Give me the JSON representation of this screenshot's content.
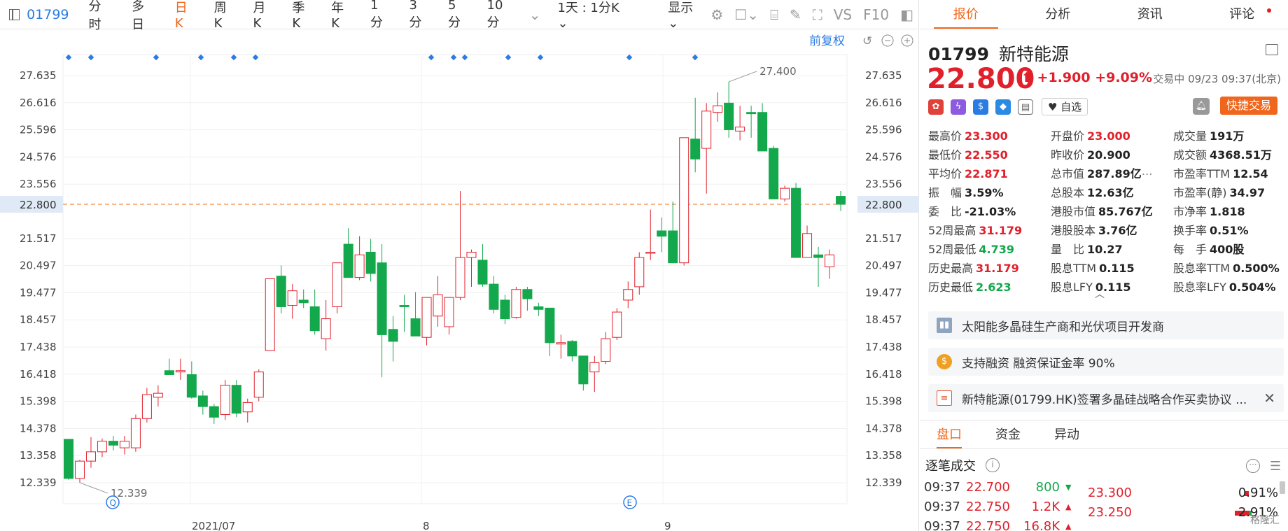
{
  "toolbar": {
    "code": "01799",
    "tabs": [
      "分时",
      "多日",
      "日K",
      "周K",
      "月K",
      "季K",
      "年K",
      "1分",
      "3分",
      "5分",
      "10分"
    ],
    "active_tab": "日K",
    "period_select": "1天 : 1分K",
    "display_select": "显示",
    "fq_label": "前复权",
    "vs_label": "VS",
    "f10_label": "F10"
  },
  "chart_data": {
    "type": "candlestick",
    "y_ticks": [
      "27.635",
      "26.616",
      "25.596",
      "24.576",
      "23.556",
      "22.800",
      "21.517",
      "20.497",
      "19.477",
      "18.457",
      "17.438",
      "16.418",
      "15.398",
      "14.378",
      "13.358",
      "12.339"
    ],
    "ylim": [
      12.339,
      27.635
    ],
    "x_labels": [
      "2021/07",
      "8",
      "9"
    ],
    "current_price_line": 22.8,
    "current_price_label": "22.800",
    "max_label": "27.400",
    "min_label": "12.339",
    "colors": {
      "up": "#e0202b",
      "down": "#14a84c",
      "price_line": "#f28a4a"
    },
    "candles": [
      {
        "o": 13.97,
        "h": 13.97,
        "l": 12.45,
        "c": 12.5
      },
      {
        "o": 12.5,
        "h": 13.2,
        "l": 12.34,
        "c": 13.15
      },
      {
        "o": 13.15,
        "h": 14.05,
        "l": 12.9,
        "c": 13.5
      },
      {
        "o": 13.5,
        "h": 14.0,
        "l": 13.3,
        "c": 13.9
      },
      {
        "o": 13.9,
        "h": 14.1,
        "l": 13.55,
        "c": 13.75
      },
      {
        "o": 13.65,
        "h": 14.1,
        "l": 13.4,
        "c": 13.9
      },
      {
        "o": 13.65,
        "h": 14.9,
        "l": 13.5,
        "c": 14.75
      },
      {
        "o": 14.75,
        "h": 15.9,
        "l": 14.6,
        "c": 15.65
      },
      {
        "o": 15.55,
        "h": 16.0,
        "l": 15.2,
        "c": 15.7
      },
      {
        "o": 16.55,
        "h": 17.0,
        "l": 16.4,
        "c": 16.4
      },
      {
        "o": 16.5,
        "h": 17.0,
        "l": 16.2,
        "c": 16.55
      },
      {
        "o": 16.4,
        "h": 16.9,
        "l": 15.5,
        "c": 15.55
      },
      {
        "o": 15.6,
        "h": 15.8,
        "l": 14.9,
        "c": 15.2
      },
      {
        "o": 15.2,
        "h": 15.3,
        "l": 14.55,
        "c": 14.8
      },
      {
        "o": 14.9,
        "h": 16.2,
        "l": 14.7,
        "c": 16.0
      },
      {
        "o": 16.0,
        "h": 16.2,
        "l": 14.8,
        "c": 14.95
      },
      {
        "o": 15.0,
        "h": 15.5,
        "l": 14.6,
        "c": 15.35
      },
      {
        "o": 15.55,
        "h": 16.6,
        "l": 15.4,
        "c": 16.5
      },
      {
        "o": 17.3,
        "h": 20.0,
        "l": 17.3,
        "c": 20.0
      },
      {
        "o": 20.1,
        "h": 20.5,
        "l": 18.7,
        "c": 18.95
      },
      {
        "o": 19.0,
        "h": 19.8,
        "l": 18.5,
        "c": 19.55
      },
      {
        "o": 19.2,
        "h": 19.6,
        "l": 18.9,
        "c": 19.1
      },
      {
        "o": 18.95,
        "h": 19.6,
        "l": 17.9,
        "c": 18.05
      },
      {
        "o": 17.75,
        "h": 19.2,
        "l": 17.3,
        "c": 18.5
      },
      {
        "o": 18.95,
        "h": 20.6,
        "l": 18.7,
        "c": 20.6
      },
      {
        "o": 21.3,
        "h": 21.9,
        "l": 20.1,
        "c": 20.05
      },
      {
        "o": 20.05,
        "h": 21.6,
        "l": 19.95,
        "c": 20.9
      },
      {
        "o": 21.0,
        "h": 21.5,
        "l": 19.9,
        "c": 20.2
      },
      {
        "o": 20.6,
        "h": 21.3,
        "l": 16.3,
        "c": 17.9
      },
      {
        "o": 18.1,
        "h": 18.6,
        "l": 16.9,
        "c": 17.65
      },
      {
        "o": 19.0,
        "h": 19.4,
        "l": 18.0,
        "c": 18.95
      },
      {
        "o": 18.5,
        "h": 19.5,
        "l": 17.9,
        "c": 17.85
      },
      {
        "o": 17.8,
        "h": 19.3,
        "l": 17.5,
        "c": 19.3
      },
      {
        "o": 18.6,
        "h": 20.1,
        "l": 18.2,
        "c": 19.4
      },
      {
        "o": 18.2,
        "h": 19.3,
        "l": 17.9,
        "c": 19.3
      },
      {
        "o": 19.3,
        "h": 23.3,
        "l": 19.2,
        "c": 20.8
      },
      {
        "o": 20.8,
        "h": 21.1,
        "l": 19.7,
        "c": 21.0
      },
      {
        "o": 20.7,
        "h": 21.3,
        "l": 19.7,
        "c": 19.8
      },
      {
        "o": 19.8,
        "h": 20.1,
        "l": 18.7,
        "c": 18.85
      },
      {
        "o": 19.2,
        "h": 19.4,
        "l": 18.3,
        "c": 18.5
      },
      {
        "o": 18.55,
        "h": 19.7,
        "l": 18.5,
        "c": 19.6
      },
      {
        "o": 19.6,
        "h": 19.7,
        "l": 18.8,
        "c": 19.25
      },
      {
        "o": 18.95,
        "h": 19.1,
        "l": 18.6,
        "c": 18.85
      },
      {
        "o": 18.9,
        "h": 18.9,
        "l": 17.1,
        "c": 17.6
      },
      {
        "o": 17.55,
        "h": 17.9,
        "l": 17.0,
        "c": 17.6
      },
      {
        "o": 17.65,
        "h": 17.7,
        "l": 16.9,
        "c": 17.1
      },
      {
        "o": 17.1,
        "h": 17.1,
        "l": 15.8,
        "c": 16.05
      },
      {
        "o": 16.5,
        "h": 17.1,
        "l": 15.75,
        "c": 16.85
      },
      {
        "o": 16.9,
        "h": 18.0,
        "l": 16.8,
        "c": 17.75
      },
      {
        "o": 17.8,
        "h": 18.9,
        "l": 17.7,
        "c": 18.75
      },
      {
        "o": 19.2,
        "h": 19.9,
        "l": 18.9,
        "c": 19.6
      },
      {
        "o": 19.7,
        "h": 21.0,
        "l": 19.4,
        "c": 20.8
      },
      {
        "o": 21.0,
        "h": 22.6,
        "l": 20.7,
        "c": 21.0
      },
      {
        "o": 21.8,
        "h": 22.3,
        "l": 21.0,
        "c": 21.6
      },
      {
        "o": 21.8,
        "h": 22.9,
        "l": 20.9,
        "c": 20.6
      },
      {
        "o": 20.6,
        "h": 25.3,
        "l": 20.5,
        "c": 25.3
      },
      {
        "o": 25.25,
        "h": 26.8,
        "l": 24.0,
        "c": 24.5
      },
      {
        "o": 24.9,
        "h": 26.6,
        "l": 23.2,
        "c": 26.3
      },
      {
        "o": 26.25,
        "h": 27.0,
        "l": 25.9,
        "c": 26.5
      },
      {
        "o": 26.6,
        "h": 27.4,
        "l": 25.3,
        "c": 25.6
      },
      {
        "o": 25.55,
        "h": 26.5,
        "l": 25.2,
        "c": 25.7
      },
      {
        "o": 26.25,
        "h": 26.5,
        "l": 25.3,
        "c": 26.2
      },
      {
        "o": 26.25,
        "h": 26.6,
        "l": 24.9,
        "c": 24.8
      },
      {
        "o": 24.9,
        "h": 25.0,
        "l": 23.0,
        "c": 23.0
      },
      {
        "o": 23.0,
        "h": 23.5,
        "l": 22.9,
        "c": 23.4
      },
      {
        "o": 23.4,
        "h": 23.6,
        "l": 21.9,
        "c": 20.8
      },
      {
        "o": 20.8,
        "h": 22.0,
        "l": 21.4,
        "c": 21.7
      },
      {
        "o": 20.9,
        "h": 21.2,
        "l": 19.7,
        "c": 20.8
      },
      {
        "o": 20.45,
        "h": 21.1,
        "l": 20.0,
        "c": 20.9
      },
      {
        "o": 23.1,
        "h": 23.3,
        "l": 22.55,
        "c": 22.8
      }
    ]
  },
  "right": {
    "tabs": [
      "报价",
      "分析",
      "资讯",
      "评论"
    ],
    "active_tab": "报价",
    "code": "01799",
    "name": "新特能源",
    "price": "22.800",
    "change": "+1.900",
    "change_pct": "+9.09%",
    "status": "交易中 09/23 09:37(北京)",
    "watch_label": "自选",
    "trade_label": "快捷交易",
    "stats": [
      [
        [
          "最高价",
          "23.300",
          "up"
        ],
        [
          "开盘价",
          "23.000",
          "up"
        ],
        [
          "成交量",
          "191万",
          "flat"
        ]
      ],
      [
        [
          "最低价",
          "22.550",
          "up"
        ],
        [
          "昨收价",
          "20.900",
          "flat"
        ],
        [
          "成交额",
          "4368.51万",
          "flat"
        ]
      ],
      [
        [
          "平均价",
          "22.871",
          "up"
        ],
        [
          "总市值",
          "287.89亿",
          "flat"
        ],
        [
          "市盈率TTM",
          "12.54",
          "flat"
        ]
      ],
      [
        [
          "振　幅",
          "3.59%",
          "flat"
        ],
        [
          "总股本",
          "12.63亿",
          "flat"
        ],
        [
          "市盈率(静)",
          "34.97",
          "flat"
        ]
      ],
      [
        [
          "委　比",
          "-21.03%",
          "flat"
        ],
        [
          "港股市值",
          "85.767亿",
          "flat"
        ],
        [
          "市净率",
          "1.818",
          "flat"
        ]
      ],
      [
        [
          "52周最高",
          "31.179",
          "up"
        ],
        [
          "港股股本",
          "3.76亿",
          "flat"
        ],
        [
          "换手率",
          "0.51%",
          "flat"
        ]
      ],
      [
        [
          "52周最低",
          "4.739",
          "down"
        ],
        [
          "量　比",
          "10.27",
          "flat"
        ],
        [
          "每　手",
          "400股",
          "flat"
        ]
      ],
      [
        [
          "历史最高",
          "31.179",
          "up"
        ],
        [
          "股息TTM",
          "0.115",
          "flat"
        ],
        [
          "股息率TTM",
          "0.500%",
          "flat"
        ]
      ],
      [
        [
          "历史最低",
          "2.623",
          "down"
        ],
        [
          "股息LFY",
          "0.115",
          "flat"
        ],
        [
          "股息率LFY",
          "0.504%",
          "flat"
        ]
      ]
    ],
    "info1": "太阳能多晶硅生产商和光伏项目开发商",
    "info2": "支持融资 融资保证金率 90%",
    "info3": "新特能源(01799.HK)签署多晶硅战略合作买卖协议 ...",
    "bottom_tabs": [
      "盘口",
      "资金",
      "异动"
    ],
    "bottom_active": "盘口",
    "ticks_title": "逐笔成交",
    "ticks": [
      {
        "time": "09:37",
        "price": "22.700",
        "vol": "800",
        "dir": "down"
      },
      {
        "time": "09:37",
        "price": "22.750",
        "vol": "1.2K",
        "dir": "up"
      },
      {
        "time": "09:37",
        "price": "22.750",
        "vol": "16.8K",
        "dir": "up"
      }
    ],
    "levels": [
      {
        "price": "23.300",
        "pct": "0.91%"
      },
      {
        "price": "23.250",
        "pct": "2.91%"
      }
    ],
    "watermark": "格隆汇"
  }
}
